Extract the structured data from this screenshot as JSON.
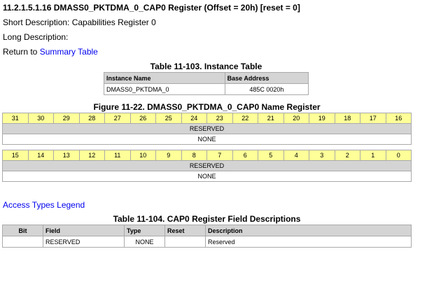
{
  "heading": "11.2.1.5.1.16 DMASS0_PKTDMA_0_CAP0 Register (Offset = 20h) [reset = 0]",
  "short_description": "Short Description: Capabilities Register 0",
  "long_description": "Long Description:",
  "return_prefix": "Return to ",
  "return_link": "Summary Table",
  "instance_table": {
    "caption": "Table 11-103. Instance Table",
    "headers": [
      "Instance Name",
      "Base Address"
    ],
    "rows": [
      [
        "DMASS0_PKTDMA_0",
        "485C 0020h"
      ]
    ]
  },
  "figure": {
    "caption": "Figure 11-22. DMASS0_PKTDMA_0_CAP0 Name Register",
    "upper_bits": [
      "31",
      "30",
      "29",
      "28",
      "27",
      "26",
      "25",
      "24",
      "23",
      "22",
      "21",
      "20",
      "19",
      "18",
      "17",
      "16"
    ],
    "lower_bits": [
      "15",
      "14",
      "13",
      "12",
      "11",
      "10",
      "9",
      "8",
      "7",
      "6",
      "5",
      "4",
      "3",
      "2",
      "1",
      "0"
    ],
    "upper_field": "RESERVED",
    "upper_reset": "NONE",
    "lower_field": "RESERVED",
    "lower_reset": "NONE"
  },
  "access_legend_link": "Access Types Legend",
  "field_table": {
    "caption": "Table 11-104. CAP0 Register Field Descriptions",
    "headers": [
      "Bit",
      "Field",
      "Type",
      "Reset",
      "Description"
    ],
    "rows": [
      [
        "",
        "RESERVED",
        "NONE",
        "",
        "Reserved"
      ]
    ]
  },
  "colors": {
    "bit_row": "#ffff99",
    "header_gray": "#d4d4d4",
    "link": "#0000ee"
  }
}
